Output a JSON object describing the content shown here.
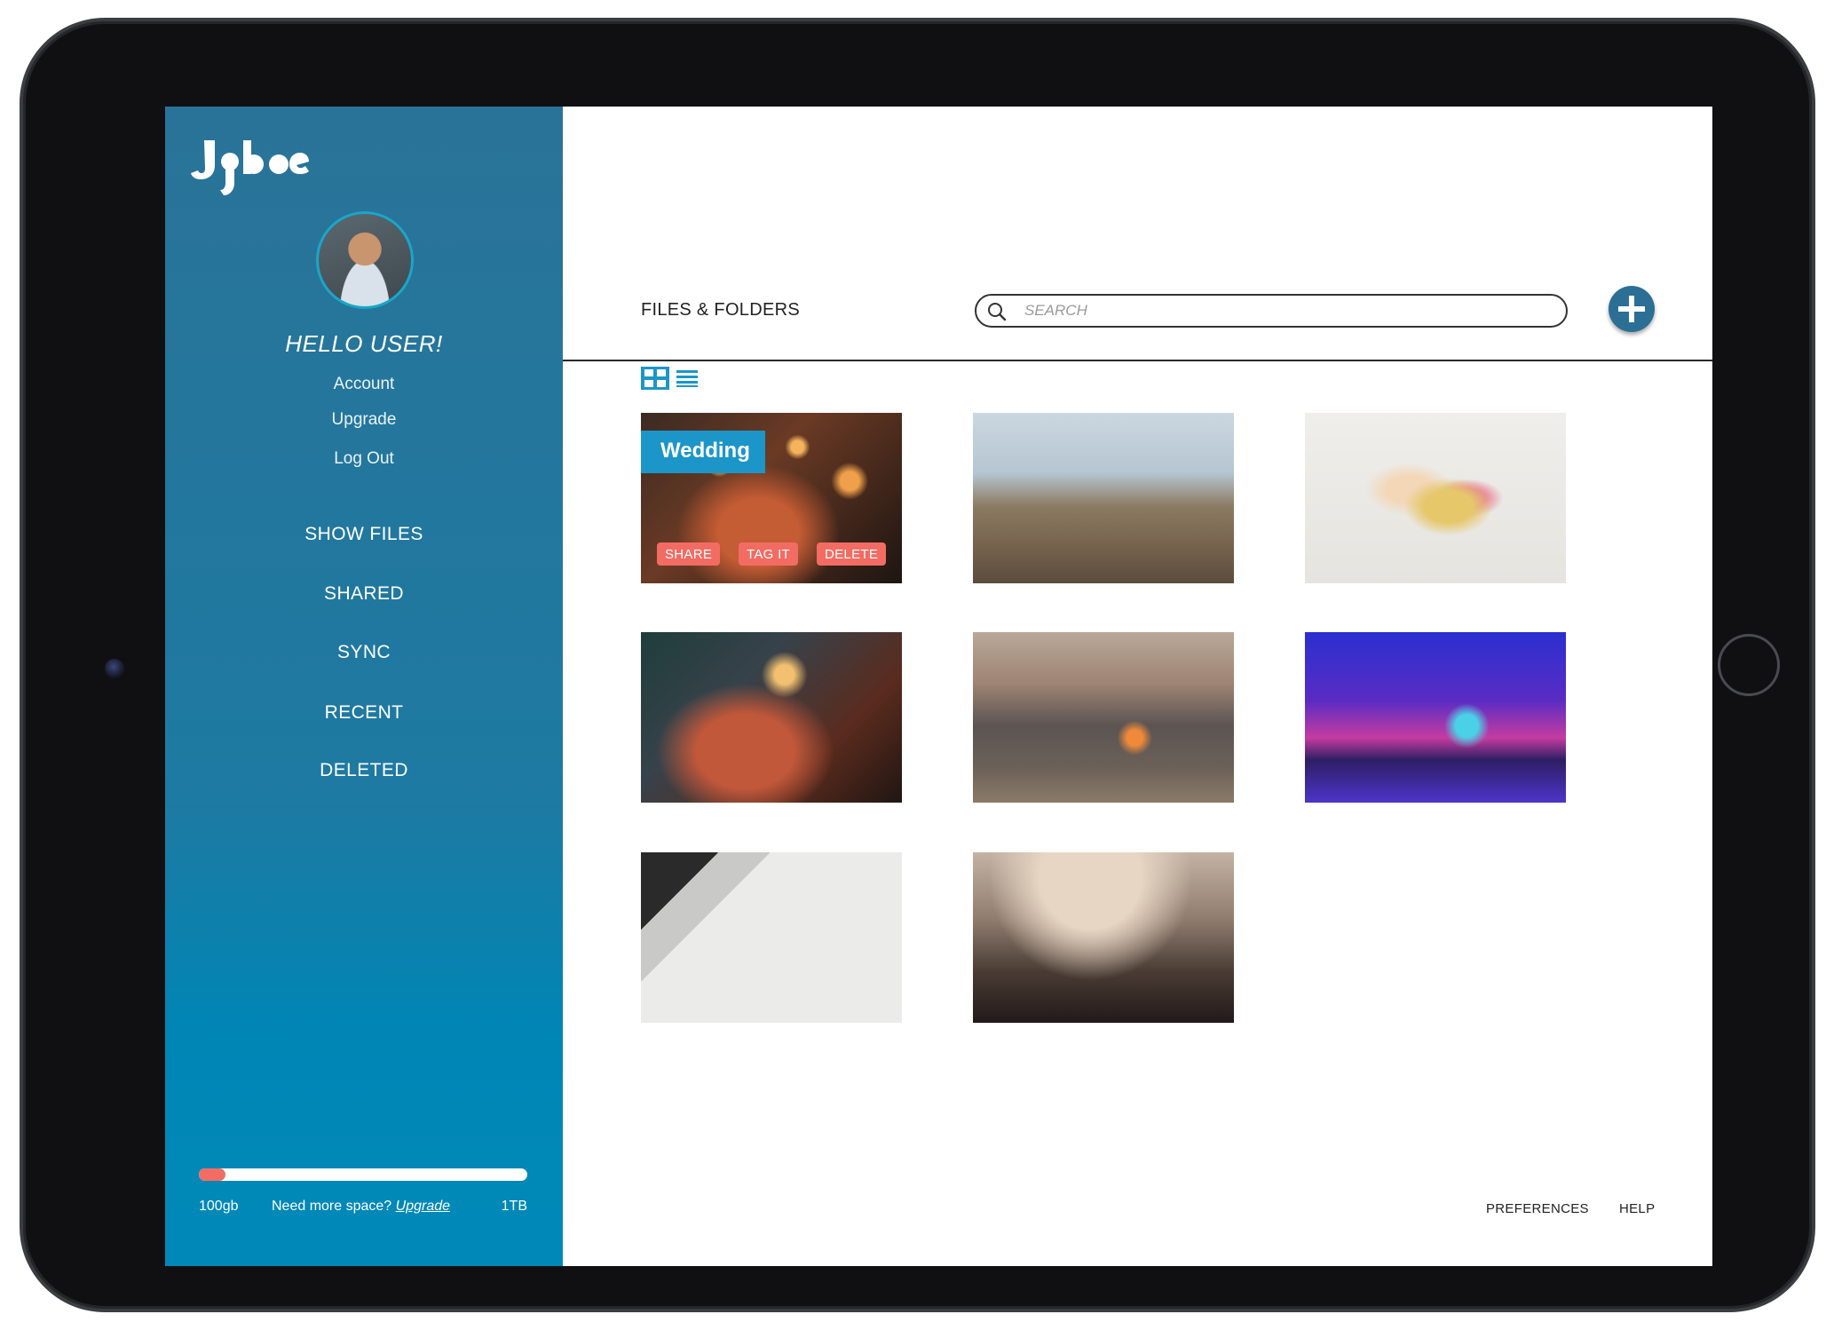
{
  "app": {
    "logo_text": "Jybe"
  },
  "sidebar": {
    "greeting": "HELLO USER!",
    "account_links": [
      "Account",
      "Upgrade",
      "Log Out"
    ],
    "nav_items": [
      "SHOW FILES",
      "SHARED",
      "SYNC",
      "RECENT",
      "DELETED"
    ],
    "storage": {
      "used_label": "100gb",
      "total_label": "1TB",
      "prompt": "Need more space?",
      "upgrade_link": "Upgrade",
      "used_fraction": 0.08,
      "bar_color": "#f26c63"
    }
  },
  "main": {
    "title": "FILES & FOLDERS",
    "search_placeholder": "SEARCH",
    "add_icon": "plus-circle-icon",
    "view_modes": [
      "grid-view-icon",
      "list-view-icon"
    ],
    "active_view": "grid",
    "files": [
      {
        "label": "Wedding",
        "actions": [
          "SHARE",
          "TAG IT",
          "DELETE"
        ]
      },
      {
        "label": ""
      },
      {
        "label": ""
      },
      {
        "label": ""
      },
      {
        "label": ""
      },
      {
        "label": ""
      },
      {
        "label": ""
      },
      {
        "label": ""
      }
    ],
    "footer_links": [
      "PREFERENCES",
      "HELP"
    ]
  },
  "colors": {
    "sidebar": "#2a7398",
    "accent": "#1c96c8",
    "action": "#f26c63",
    "add_button": "#2c6f94"
  }
}
